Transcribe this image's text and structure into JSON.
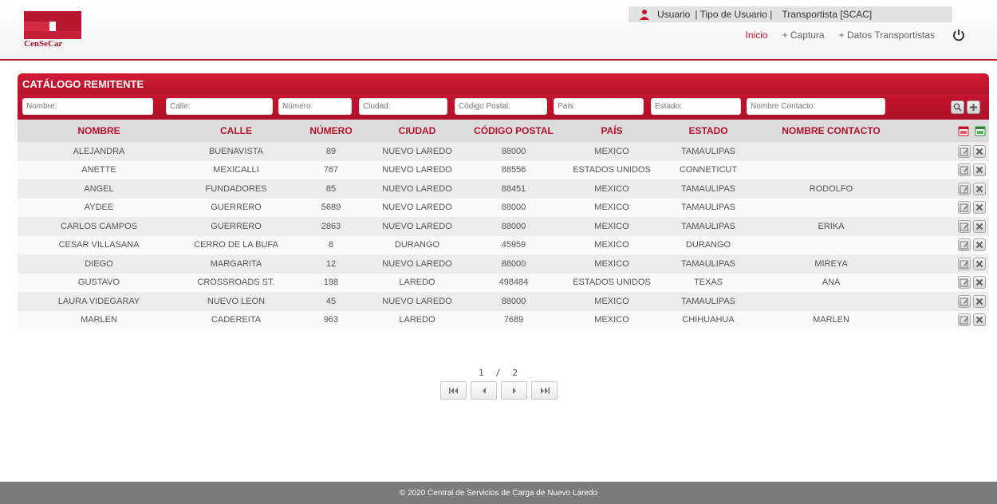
{
  "header": {
    "logo_text": "CenSeCar",
    "user": {
      "usuario": "Usuario",
      "tipo": "| Tipo de Usuario |",
      "tipo_value": "Transportista [SCAC]"
    },
    "nav": {
      "inicio": "Inicio",
      "captura": "+ Captura",
      "datos": "+ Datos Transportistas"
    }
  },
  "catalog": {
    "title": "CATÁLOGO REMITENTE",
    "filters": {
      "nombre": "Nombre:",
      "calle": "Calle:",
      "numero": "Número:",
      "ciudad": "Ciudad:",
      "cp": "Código Postal:",
      "pais": "Pais:",
      "estado": "Estado:",
      "contacto": "Nombre Contacto:"
    },
    "columns": [
      "NOMBRE",
      "CALLE",
      "NÚMERO",
      "CIUDAD",
      "CÓDIGO POSTAL",
      "PAÍS",
      "ESTADO",
      "NOMBRE CONTACTO"
    ],
    "rows": [
      [
        "ALEJANDRA",
        "BUENAVISTA",
        "89",
        "NUEVO LAREDO",
        "88000",
        "MEXICO",
        "TAMAULIPAS",
        ""
      ],
      [
        "ANETTE",
        "MEXICALLI",
        "787",
        "NUEVO LAREDO",
        "88556",
        "ESTADOS UNIDOS",
        "CONNETICUT",
        ""
      ],
      [
        "ANGEL",
        "FUNDADORES",
        "85",
        "NUEVO LAREDO",
        "88451",
        "MEXICO",
        "TAMAULIPAS",
        "RODOLFO"
      ],
      [
        "AYDEE",
        "GUERRERO",
        "5689",
        "NUEVO LAREDO",
        "88000",
        "MEXICO",
        "TAMAULIPAS",
        ""
      ],
      [
        "CARLOS CAMPOS",
        "GUERRERO",
        "2863",
        "NUEVO LAREDO",
        "88000",
        "MEXICO",
        "TAMAULIPAS",
        "ERIKA"
      ],
      [
        "CESAR VILLASANA",
        "CERRO DE LA BUFA",
        "8",
        "DURANGO",
        "45959",
        "MEXICO",
        "DURANGO",
        ""
      ],
      [
        "DIEGO",
        "MARGARITA",
        "12",
        "NUEVO LAREDO",
        "88000",
        "MEXICO",
        "TAMAULIPAS",
        "MIREYA"
      ],
      [
        "GUSTAVO",
        "CROSSROADS ST.",
        "198",
        "LAREDO",
        "498484",
        "ESTADOS UNIDOS",
        "TEXAS",
        "ANA"
      ],
      [
        "LAURA VIDEGARAY",
        "NUEVO LEON",
        "45",
        "NUEVO LAREDO",
        "88000",
        "MEXICO",
        "TAMAULIPAS",
        ""
      ],
      [
        "MARLEN",
        "CADEREITA",
        "963",
        "LAREDO",
        "7689",
        "MEXICO",
        "CHIHUAHUA",
        "MARLEN"
      ]
    ]
  },
  "pager": {
    "current": "1",
    "sep": "/",
    "total": "2"
  },
  "footer": {
    "text": "© 2020 Central de Servicios de Carga de Nuevo Laredo"
  },
  "colors": {
    "brand_red": "#b8182f",
    "header_row": "#dcdcdc",
    "footer": "#7b7b7b"
  }
}
